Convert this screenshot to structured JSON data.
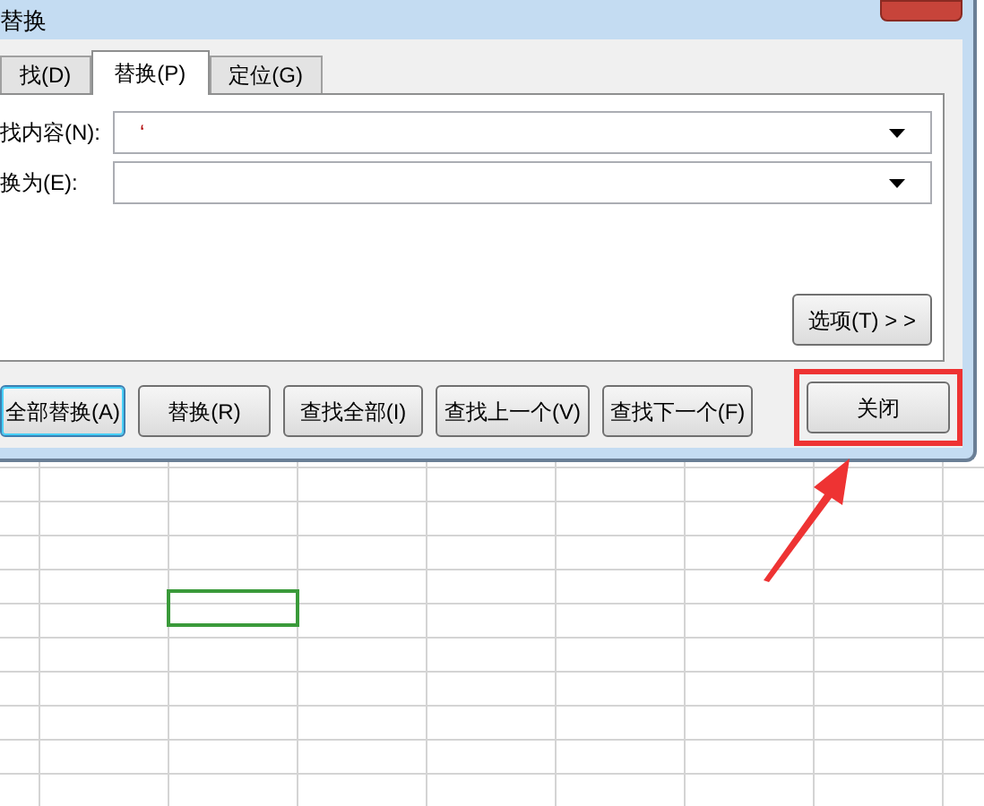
{
  "dialog": {
    "title": "替换",
    "tabs": [
      {
        "label": "找(D)",
        "selected": false
      },
      {
        "label": "替换(P)",
        "selected": true
      },
      {
        "label": "定位(G)",
        "selected": false
      }
    ],
    "fields": [
      {
        "label": "找内容(N):",
        "value": "‘"
      },
      {
        "label": "换为(E):"
      }
    ],
    "options_button": "选项(T) > >",
    "buttons": [
      {
        "label": "全部替换(A)",
        "default": true
      },
      {
        "label": "替换(R)",
        "default": false
      },
      {
        "label": "查找全部(I)",
        "default": false
      },
      {
        "label": "查找上一个(V)",
        "default": false
      },
      {
        "label": "查找下一个(F)",
        "default": false
      }
    ],
    "close_button": {
      "label": "关闭",
      "highlighted": true
    }
  }
}
